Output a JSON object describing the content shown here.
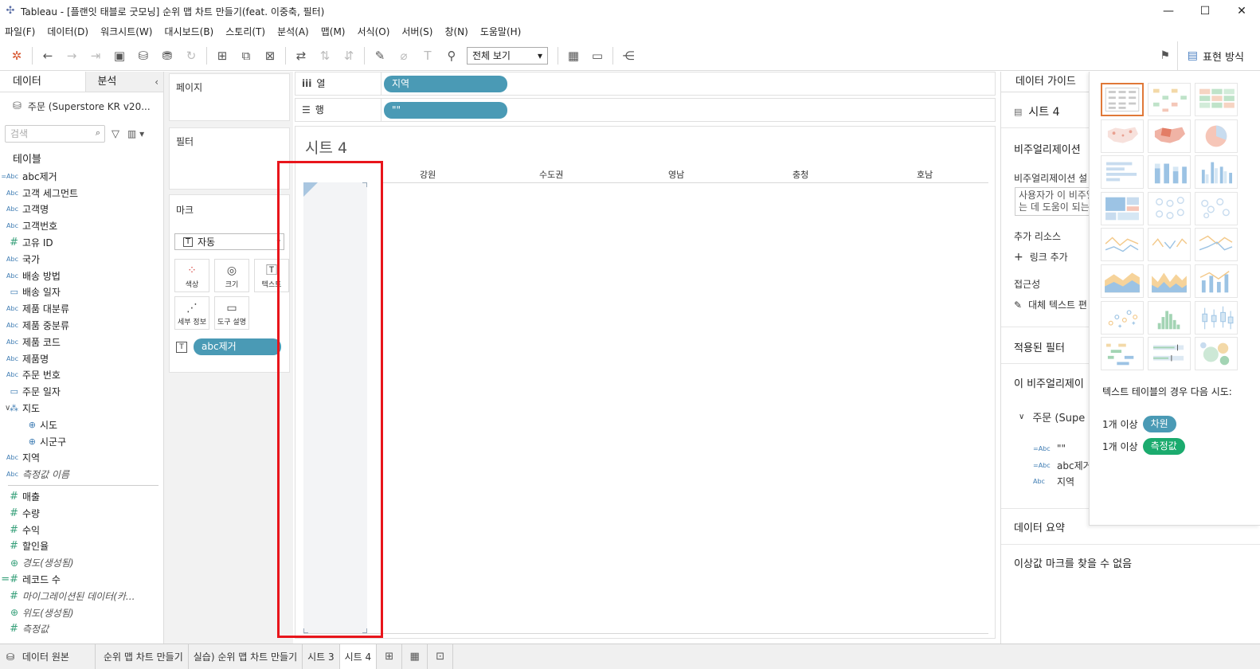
{
  "window": {
    "title": "Tableau - [플랜잇 태블로 굿모닝] 순위 맵 차트 만들기(feat. 이중축, 필터)",
    "controls": [
      "—",
      "☐",
      "✕"
    ]
  },
  "menu": [
    "파일(F)",
    "데이터(D)",
    "워크시트(W)",
    "대시보드(B)",
    "스토리(T)",
    "분석(A)",
    "맵(M)",
    "서식(O)",
    "서버(S)",
    "창(N)",
    "도움말(H)"
  ],
  "toolbar": {
    "fit_label": "전체 보기",
    "show_me_label": "표현 방식"
  },
  "left": {
    "tab_data": "데이터",
    "tab_analytics": "분석",
    "datasource": "주문 (Superstore KR v20...",
    "search_placeholder": "검색",
    "tables_header": "테이블",
    "fields": [
      {
        "t": "=Abc",
        "n": "abc제거"
      },
      {
        "t": "Abc",
        "n": "고객 세그먼트"
      },
      {
        "t": "Abc",
        "n": "고객명"
      },
      {
        "t": "Abc",
        "n": "고객번호"
      },
      {
        "t": "#",
        "n": "고유 ID"
      },
      {
        "t": "Abc",
        "n": "국가"
      },
      {
        "t": "Abc",
        "n": "배송 방법"
      },
      {
        "t": "▭",
        "n": "배송 일자"
      },
      {
        "t": "Abc",
        "n": "제품 대분류"
      },
      {
        "t": "Abc",
        "n": "제품 중분류"
      },
      {
        "t": "Abc",
        "n": "제품 코드"
      },
      {
        "t": "Abc",
        "n": "제품명"
      },
      {
        "t": "Abc",
        "n": "주문 번호"
      },
      {
        "t": "▭",
        "n": "주문 일자"
      },
      {
        "t": "⁂",
        "n": "지도"
      },
      {
        "t": "⊕",
        "n": "시도"
      },
      {
        "t": "⊕",
        "n": "시군구"
      },
      {
        "t": "Abc",
        "n": "지역"
      },
      {
        "t": "Abc",
        "n": "측정값 이름"
      },
      {
        "t": "#",
        "n": "매출"
      },
      {
        "t": "#",
        "n": "수량"
      },
      {
        "t": "#",
        "n": "수익"
      },
      {
        "t": "#",
        "n": "할인율"
      },
      {
        "t": "⊕",
        "n": "경도(생성됨)"
      },
      {
        "t": "=#",
        "n": "레코드 수"
      },
      {
        "t": "#",
        "n": "마이그레이션된 데이터(카..."
      },
      {
        "t": "⊕",
        "n": "위도(생성됨)"
      },
      {
        "t": "#",
        "n": "측정값"
      }
    ]
  },
  "cards": {
    "pages": "페이지",
    "filters": "필터",
    "marks": "마크",
    "mark_type": "자동",
    "buttons": [
      "색상",
      "크기",
      "텍스트",
      "세부 정보",
      "도구 설명"
    ],
    "mark_pill": "abc제거"
  },
  "shelves": {
    "columns_label": "열",
    "columns_pill": "지역",
    "rows_label": "행",
    "rows_pill": "\"\""
  },
  "view": {
    "sheet_title": "시트 4",
    "column_headers": [
      "강원",
      "수도권",
      "영남",
      "충청",
      "호남"
    ]
  },
  "guide": {
    "tab": "데이터 가이드",
    "sheet": "시트 4",
    "viz_section": "비주얼리제이션",
    "viz_desc_label": "비주얼리제이션 설",
    "viz_desc_placeholder": "사용자가 이 비주얼리제이션을 이해하는 데 도움이 되는 설명을 입력",
    "resources": "추가 리소스",
    "add_link": "링크 추가",
    "accessibility": "접근성",
    "alt_text": "대체 텍스트 편",
    "applied_filters": "적용된 필터",
    "this_viz": "이 비주얼리제이",
    "ds_item": "주문 (Supe",
    "used_fields": [
      {
        "t": "=Abc",
        "n": "\"\""
      },
      {
        "t": "=Abc",
        "n": "abc제거"
      },
      {
        "t": "Abc",
        "n": "지역"
      }
    ],
    "data_summary": "데이터 요약",
    "outliers": "이상값 마크를 찾을 수 없음"
  },
  "show_me": {
    "hint": "텍스트 테이블의 경우 다음 시도:",
    "req1_prefix": "1개 이상",
    "req1_badge": "차원",
    "req2_prefix": "1개 이상",
    "req2_badge": "측정값",
    "badge_colors": {
      "dimension": "#4a9ab5",
      "measure": "#1bab6e"
    }
  },
  "bottom": {
    "datasource_tab": "데이터 원본",
    "sheets": [
      "순위 맵 차트 만들기",
      "실습) 순위 맵 차트 만들기",
      "시트 3",
      "시트 4"
    ],
    "active_sheet": "시트 4"
  }
}
